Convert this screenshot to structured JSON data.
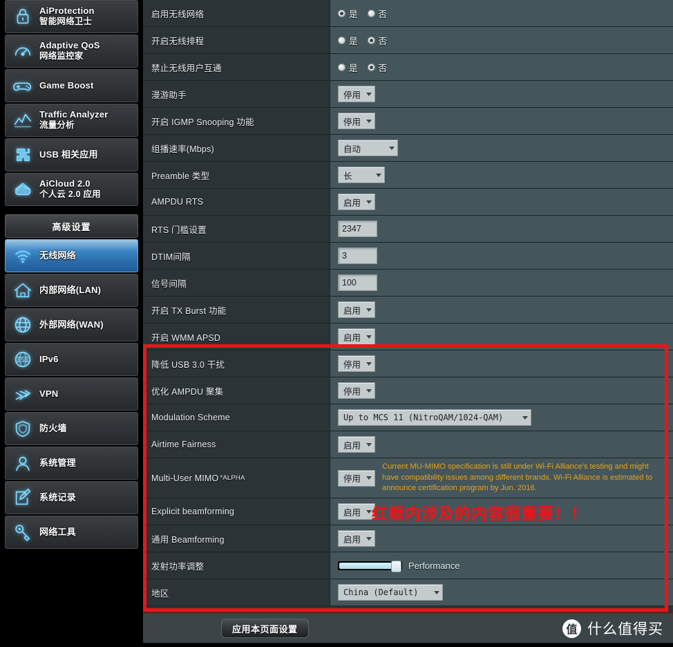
{
  "sidebar": {
    "top_items": [
      {
        "icon": "shield-lock-icon",
        "l1": "AiProtection",
        "l2": "智能网络卫士"
      },
      {
        "icon": "gauge-icon",
        "l1": "Adaptive QoS",
        "l2": "网络监控家"
      },
      {
        "icon": "gamepad-icon",
        "l1": "Game Boost",
        "l2": ""
      },
      {
        "icon": "chart-line-icon",
        "l1": "Traffic Analyzer",
        "l2": "流量分析"
      },
      {
        "icon": "puzzle-icon",
        "l1": "USB 相关应用",
        "l2": ""
      },
      {
        "icon": "cloud-house-icon",
        "l1": "AiCloud 2.0",
        "l2": "个人云 2.0 应用"
      }
    ],
    "section_title": "高级设置",
    "adv_items": [
      {
        "icon": "wifi-icon",
        "l1": "无线网络",
        "l2": "",
        "active": true
      },
      {
        "icon": "house-icon",
        "l1": "内部网络(LAN)",
        "l2": "",
        "active": false
      },
      {
        "icon": "globe-icon",
        "l1": "外部网络(WAN)",
        "l2": "",
        "active": false
      },
      {
        "icon": "ipv6-globe-icon",
        "l1": "IPv6",
        "l2": "",
        "active": false
      },
      {
        "icon": "vpn-key-icon",
        "l1": "VPN",
        "l2": "",
        "active": false
      },
      {
        "icon": "shield-icon",
        "l1": "防火墙",
        "l2": "",
        "active": false
      },
      {
        "icon": "user-icon",
        "l1": "系统管理",
        "l2": "",
        "active": false
      },
      {
        "icon": "pencil-note-icon",
        "l1": "系统记录",
        "l2": "",
        "active": false
      },
      {
        "icon": "wrench-icon",
        "l1": "网络工具",
        "l2": "",
        "active": false
      }
    ]
  },
  "rows": [
    {
      "label": "启用无线网络",
      "type": "radio",
      "options": [
        "是",
        "否"
      ],
      "selected": 0
    },
    {
      "label": "开启无线排程",
      "type": "radio",
      "options": [
        "是",
        "否"
      ],
      "selected": 1
    },
    {
      "label": "禁止无线用户互通",
      "type": "radio",
      "options": [
        "是",
        "否"
      ],
      "selected": 1
    },
    {
      "label": "漫游助手",
      "type": "select",
      "value": "停用",
      "width": "w-sm"
    },
    {
      "label": "开启 IGMP Snooping 功能",
      "type": "select",
      "value": "停用",
      "width": "w-sm"
    },
    {
      "label": "组播速率(Mbps)",
      "type": "select",
      "value": "自动",
      "width": "w-lg"
    },
    {
      "label": "Preamble 类型",
      "type": "select",
      "value": "长",
      "width": "w-md"
    },
    {
      "label": "AMPDU RTS",
      "type": "select",
      "value": "启用",
      "width": "w-sm"
    },
    {
      "label": "RTS 门槛设置",
      "type": "input",
      "value": "2347"
    },
    {
      "label": "DTIM间隔",
      "type": "input",
      "value": "3"
    },
    {
      "label": "信号间隔",
      "type": "input",
      "value": "100"
    },
    {
      "label": "开启 TX Burst 功能",
      "type": "select",
      "value": "启用",
      "width": "w-sm"
    },
    {
      "label": "开启 WMM APSD",
      "type": "select",
      "value": "启用",
      "width": "w-sm"
    },
    {
      "label": "降低 USB 3.0 干扰",
      "type": "select",
      "value": "停用",
      "width": "w-sm"
    },
    {
      "label": "优化 AMPDU 聚集",
      "type": "select",
      "value": "停用",
      "width": "w-sm"
    },
    {
      "label": "Modulation Scheme",
      "type": "select-mono",
      "value": "Up to MCS 11 (NitroQAM/1024-QAM)",
      "width": "w-xxl"
    },
    {
      "label": "Airtime Fairness",
      "type": "select",
      "value": "启用",
      "width": "w-sm"
    },
    {
      "label": "Multi-User MIMO",
      "sup": "*ALPHA",
      "type": "select-note",
      "value": "停用",
      "width": "w-sm",
      "note": "Current MU-MIMO specification is still under Wi-Fi Alliance's testing and might have compatibility issues among different brands. Wi-Fi Alliance is estimated to announce certification program by Jun. 2016."
    },
    {
      "label": "Explicit beamforming",
      "type": "select",
      "value": "启用",
      "width": "w-sm"
    },
    {
      "label": "通用 Beamforming",
      "type": "select",
      "value": "启用",
      "width": "w-sm"
    },
    {
      "label": "发射功率调整",
      "type": "slider",
      "slider_label": "Performance",
      "percent": 100
    },
    {
      "label": "地区",
      "type": "select-mono",
      "value": "China (Default)",
      "width": "w-xl"
    }
  ],
  "annotation": {
    "text": "红框内涉及的内容很重要！！",
    "box_color": "#e8161b"
  },
  "footer": {
    "apply_label": "应用本页面设置",
    "watermark_badge": "值",
    "watermark_text": "什么值得买"
  }
}
